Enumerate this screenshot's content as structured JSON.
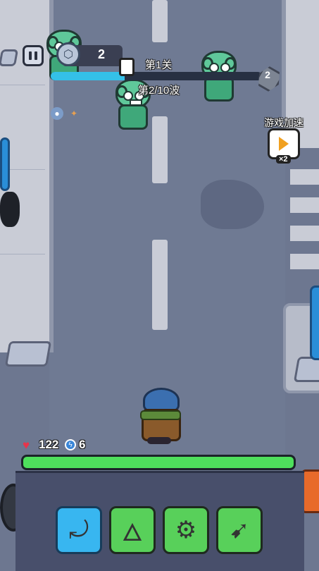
{
  "hud": {
    "pause_icon": "pause-icon",
    "coin_icon": "hex-nut-icon",
    "coin_count": "2",
    "wave_progress": 0.35,
    "stage_label": "第1关",
    "wave_label": "第2/10波",
    "level_badge": "2",
    "buffs": [
      {
        "icon": "money-bag-icon"
      },
      {
        "icon": "gun-icon"
      }
    ],
    "speed_label": "游戏加速",
    "speed_multiplier": "×2"
  },
  "player": {
    "hp": "122",
    "shield": "6",
    "hp_fill": 1.0,
    "colors": {
      "hp_bar": "#4ee05c",
      "wave_bar": "#34c0e8"
    }
  },
  "weapons": [
    {
      "name": "boomerang-icon",
      "slot_color": "#38b6f0"
    },
    {
      "name": "molotov-icon",
      "slot_color": "#58d05a"
    },
    {
      "name": "drill-bomb-icon",
      "slot_color": "#58d05a"
    },
    {
      "name": "kunai-icon",
      "slot_color": "#58d05a"
    }
  ]
}
